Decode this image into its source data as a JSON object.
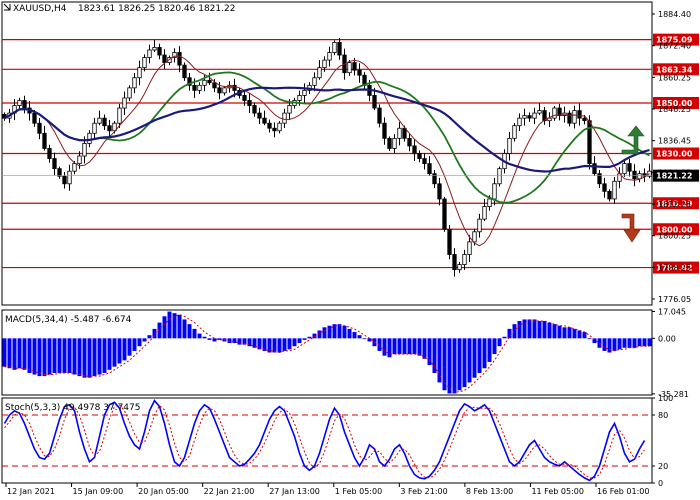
{
  "header": {
    "symbol": "XAUUSD,H4",
    "ohlc": "1823.61 1826.25 1820.46 1821.22"
  },
  "chart_data": [
    {
      "type": "candlestick",
      "name": "price",
      "y_ticks": [
        "1884.40",
        "1872.40",
        "1860.25",
        "1848.25",
        "1836.45",
        "1824.25",
        "1812.25",
        "1800.25",
        "1788.25",
        "1776.05"
      ],
      "ylim": [
        1770,
        1890
      ],
      "levels": [
        {
          "label": "1875.09",
          "value": 1875.09
        },
        {
          "label": "1863.34",
          "value": 1863.34
        },
        {
          "label": "1850.00",
          "value": 1850.0
        },
        {
          "label": "1830.00",
          "value": 1830.0
        },
        {
          "label": "1810.29",
          "value": 1810.29
        },
        {
          "label": "1800.00",
          "value": 1800.0
        },
        {
          "label": "1784.82",
          "value": 1784.82
        }
      ],
      "current_price": "1821.22",
      "current_value": 1821.22,
      "arrows": {
        "up": "green-up-arrow",
        "down": "red-down-arrow"
      },
      "colors": {
        "bull_body": "#ffffff",
        "bear_body": "#000000",
        "ma_fast": "#8b1a1a",
        "ma_mid": "#1f7a1f",
        "ma_slow": "#1a1a7a",
        "level": "#d40000",
        "arrow_up": "#2e7d32",
        "arrow_down": "#b33a1a"
      },
      "closes": [
        1844,
        1846,
        1849,
        1851,
        1848,
        1846,
        1842,
        1838,
        1832,
        1828,
        1824,
        1821,
        1818,
        1823,
        1826,
        1829,
        1834,
        1838,
        1842,
        1844,
        1841,
        1839,
        1842,
        1848,
        1852,
        1856,
        1860,
        1864,
        1868,
        1871,
        1872,
        1869,
        1866,
        1868,
        1870,
        1865,
        1860,
        1857,
        1855,
        1857,
        1859,
        1858,
        1856,
        1854,
        1856,
        1857,
        1855,
        1853,
        1851,
        1849,
        1846,
        1844,
        1842,
        1840,
        1839,
        1842,
        1846,
        1849,
        1851,
        1853,
        1855,
        1857,
        1860,
        1864,
        1867,
        1870,
        1874,
        1869,
        1862,
        1866,
        1863,
        1861,
        1857,
        1853,
        1848,
        1842,
        1836,
        1832,
        1836,
        1840,
        1836,
        1833,
        1830,
        1828,
        1826,
        1822,
        1818,
        1812,
        1800,
        1790,
        1784,
        1786,
        1790,
        1795,
        1799,
        1804,
        1809,
        1812,
        1818,
        1824,
        1830,
        1836,
        1841,
        1844,
        1845,
        1844,
        1846,
        1847,
        1843,
        1844,
        1848,
        1845,
        1846,
        1842,
        1847,
        1844,
        1843,
        1826,
        1822,
        1818,
        1815,
        1812,
        1819,
        1822,
        1826,
        1823,
        1820,
        1822,
        1821,
        1823
      ]
    },
    {
      "type": "histogram",
      "name": "MACD",
      "label": "MACD(5,34,4) -5.487 -6.674",
      "y_ticks": [
        "17.045",
        "0.00",
        "-35.281"
      ],
      "ylim": [
        -36,
        18
      ],
      "colors": {
        "bars": "#0000ff",
        "signal": "#d40000"
      },
      "values": [
        -18,
        -19,
        -20,
        -19,
        -20,
        -22,
        -23,
        -24,
        -24,
        -23,
        -22,
        -22,
        -22,
        -22,
        -23,
        -24,
        -25,
        -25,
        -24,
        -23,
        -22,
        -20,
        -18,
        -16,
        -14,
        -11,
        -8,
        -5,
        -2,
        2,
        6,
        10,
        14,
        17,
        16,
        15,
        12,
        9,
        6,
        3,
        1,
        -1,
        -2,
        -1,
        -2,
        -3,
        -3,
        -4,
        -4,
        -5,
        -6,
        -7,
        -8,
        -9,
        -9,
        -9,
        -8,
        -7,
        -5,
        -3,
        -1,
        1,
        3,
        5,
        7,
        8,
        9,
        9,
        8,
        6,
        4,
        2,
        0,
        -2,
        -5,
        -8,
        -11,
        -12,
        -10,
        -10,
        -10,
        -10,
        -10,
        -11,
        -13,
        -17,
        -22,
        -28,
        -33,
        -35,
        -35,
        -33,
        -31,
        -28,
        -25,
        -22,
        -19,
        -15,
        -10,
        -5,
        1,
        6,
        9,
        11,
        12,
        12,
        12,
        11,
        11,
        10,
        9,
        8,
        7,
        7,
        6,
        5,
        4,
        0,
        -3,
        -6,
        -8,
        -9,
        -8,
        -7,
        -6,
        -6,
        -6,
        -5,
        -5,
        -5
      ],
      "signal": [
        -18,
        -18,
        -19,
        -19,
        -19,
        -20,
        -21,
        -22,
        -23,
        -23,
        -23,
        -22,
        -22,
        -22,
        -22,
        -23,
        -24,
        -24,
        -24,
        -24,
        -23,
        -22,
        -20,
        -18,
        -16,
        -14,
        -11,
        -8,
        -5,
        -2,
        2,
        6,
        9,
        12,
        14,
        15,
        14,
        12,
        10,
        7,
        4,
        2,
        0,
        -1,
        -1,
        -2,
        -2,
        -3,
        -3,
        -4,
        -5,
        -6,
        -7,
        -8,
        -8,
        -9,
        -8,
        -8,
        -7,
        -5,
        -3,
        -1,
        1,
        3,
        5,
        6,
        8,
        8,
        8,
        7,
        6,
        4,
        2,
        0,
        -2,
        -5,
        -8,
        -10,
        -10,
        -10,
        -10,
        -10,
        -10,
        -10,
        -12,
        -14,
        -18,
        -23,
        -28,
        -32,
        -34,
        -34,
        -33,
        -31,
        -28,
        -25,
        -22,
        -18,
        -14,
        -9,
        -4,
        1,
        5,
        8,
        10,
        11,
        11,
        11,
        11,
        10,
        9,
        8,
        8,
        7,
        6,
        5,
        4,
        2,
        -1,
        -3,
        -6,
        -7,
        -8,
        -7,
        -7,
        -6,
        -6,
        -5,
        -5,
        -5
      ]
    },
    {
      "type": "line",
      "name": "Stochastic",
      "label": "Stoch(5,3,3) 49.4978 37.7475",
      "y_ticks": [
        "100",
        "80",
        "20",
        "0"
      ],
      "ylim": [
        0,
        100
      ],
      "levels": [
        80,
        20
      ],
      "colors": {
        "main": "#0000ff",
        "signal": "#d40000",
        "level": "#d40000"
      },
      "k": [
        70,
        80,
        85,
        82,
        70,
        55,
        40,
        30,
        28,
        35,
        55,
        75,
        90,
        92,
        85,
        60,
        40,
        25,
        30,
        55,
        80,
        92,
        95,
        88,
        70,
        55,
        45,
        40,
        60,
        85,
        97,
        90,
        70,
        45,
        25,
        20,
        30,
        50,
        70,
        85,
        92,
        88,
        75,
        60,
        45,
        30,
        25,
        20,
        22,
        28,
        35,
        45,
        60,
        75,
        85,
        90,
        85,
        70,
        55,
        35,
        20,
        15,
        20,
        35,
        55,
        75,
        88,
        80,
        60,
        45,
        30,
        20,
        30,
        45,
        40,
        25,
        20,
        28,
        40,
        45,
        35,
        20,
        10,
        6,
        5,
        8,
        15,
        25,
        40,
        55,
        70,
        85,
        93,
        90,
        85,
        88,
        92,
        85,
        70,
        55,
        40,
        25,
        20,
        25,
        35,
        45,
        50,
        40,
        30,
        25,
        22,
        20,
        25,
        20,
        15,
        10,
        6,
        3,
        8,
        20,
        40,
        60,
        70,
        55,
        35,
        25,
        28,
        40,
        50
      ],
      "d": [
        65,
        72,
        80,
        83,
        80,
        70,
        55,
        42,
        32,
        31,
        40,
        55,
        75,
        88,
        89,
        80,
        62,
        42,
        32,
        37,
        55,
        76,
        90,
        92,
        85,
        72,
        58,
        48,
        48,
        62,
        80,
        91,
        86,
        68,
        47,
        30,
        25,
        32,
        50,
        68,
        82,
        88,
        85,
        75,
        60,
        45,
        33,
        25,
        22,
        23,
        28,
        36,
        47,
        60,
        73,
        83,
        87,
        82,
        70,
        53,
        37,
        23,
        18,
        23,
        37,
        55,
        73,
        81,
        76,
        62,
        45,
        32,
        26,
        31,
        38,
        37,
        29,
        24,
        29,
        38,
        40,
        33,
        22,
        12,
        7,
        6,
        9,
        16,
        27,
        40,
        55,
        70,
        83,
        89,
        89,
        88,
        88,
        88,
        82,
        70,
        55,
        40,
        28,
        23,
        27,
        35,
        43,
        45,
        40,
        32,
        26,
        22,
        22,
        22,
        20,
        15,
        10,
        6,
        6,
        10,
        22,
        40,
        57,
        62,
        53,
        38,
        29,
        31,
        39
      ]
    }
  ],
  "x_axis": {
    "labels": [
      "12 Jan 2021",
      "15 Jan 09:00",
      "20 Jan 05:00",
      "22 Jan 21:00",
      "27 Jan 13:00",
      "1 Feb 05:00",
      "3 Feb 21:00",
      "8 Feb 13:00",
      "11 Feb 05:00",
      "16 Feb 01:00"
    ]
  }
}
